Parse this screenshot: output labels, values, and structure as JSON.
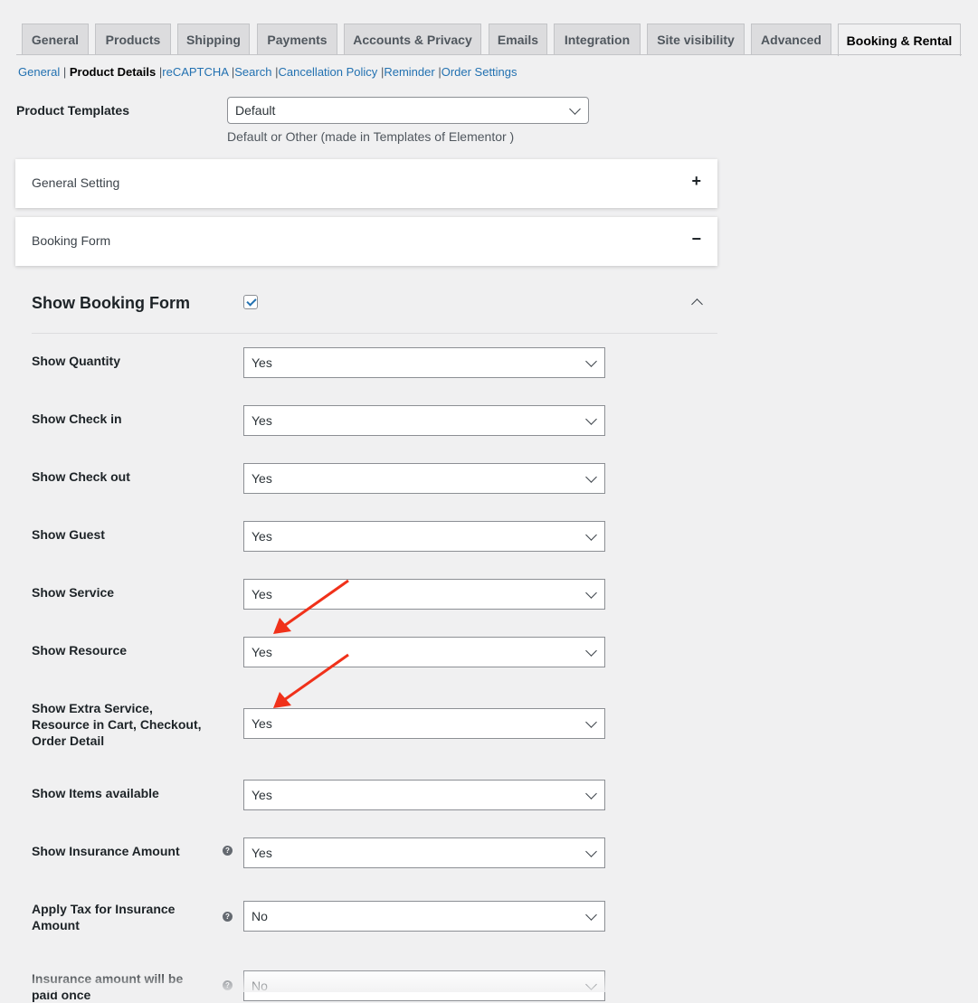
{
  "tabs": [
    {
      "label": "General"
    },
    {
      "label": "Products"
    },
    {
      "label": "Shipping"
    },
    {
      "label": "Payments"
    },
    {
      "label": "Accounts & Privacy"
    },
    {
      "label": "Emails"
    },
    {
      "label": "Integration"
    },
    {
      "label": "Site visibility"
    },
    {
      "label": "Advanced"
    },
    {
      "label": "Booking & Rental",
      "active": true
    }
  ],
  "subnav": {
    "items": [
      "General",
      "Product Details",
      "reCAPTCHA",
      "Search",
      "Cancellation Policy",
      "Reminder",
      "Order Settings"
    ],
    "current": "Product Details",
    "separator": "|"
  },
  "product_templates": {
    "label": "Product Templates",
    "value": "Default",
    "description": "Default or Other (made in Templates of Elementor )"
  },
  "panels": {
    "general_setting": {
      "title": "General Setting",
      "toggle": "+"
    },
    "booking_form": {
      "title": "Booking Form",
      "toggle": "−"
    }
  },
  "booking_form": {
    "title": "Show Booking Form",
    "enabled": true,
    "fields": [
      {
        "label": "Show Quantity",
        "value": "Yes"
      },
      {
        "label": "Show Check in",
        "value": "Yes"
      },
      {
        "label": "Show Check out",
        "value": "Yes"
      },
      {
        "label": "Show Guest",
        "value": "Yes"
      },
      {
        "label": "Show Service",
        "value": "Yes"
      },
      {
        "label": "Show Resource",
        "value": "Yes"
      },
      {
        "label": "Show Extra Service, Resource in Cart, Checkout, Order Detail",
        "value": "Yes"
      },
      {
        "label": "Show Items available",
        "value": "Yes"
      },
      {
        "label": "Show Insurance Amount",
        "value": "Yes",
        "help": "?"
      },
      {
        "label": "Apply Tax for Insurance Amount",
        "value": "No",
        "help": "?"
      },
      {
        "label": "Insurance amount will be paid once",
        "value": "No",
        "help": "?"
      }
    ]
  },
  "colors": {
    "link": "#2271b1",
    "arrow": "#f0311a",
    "background": "#f0f0f1"
  }
}
